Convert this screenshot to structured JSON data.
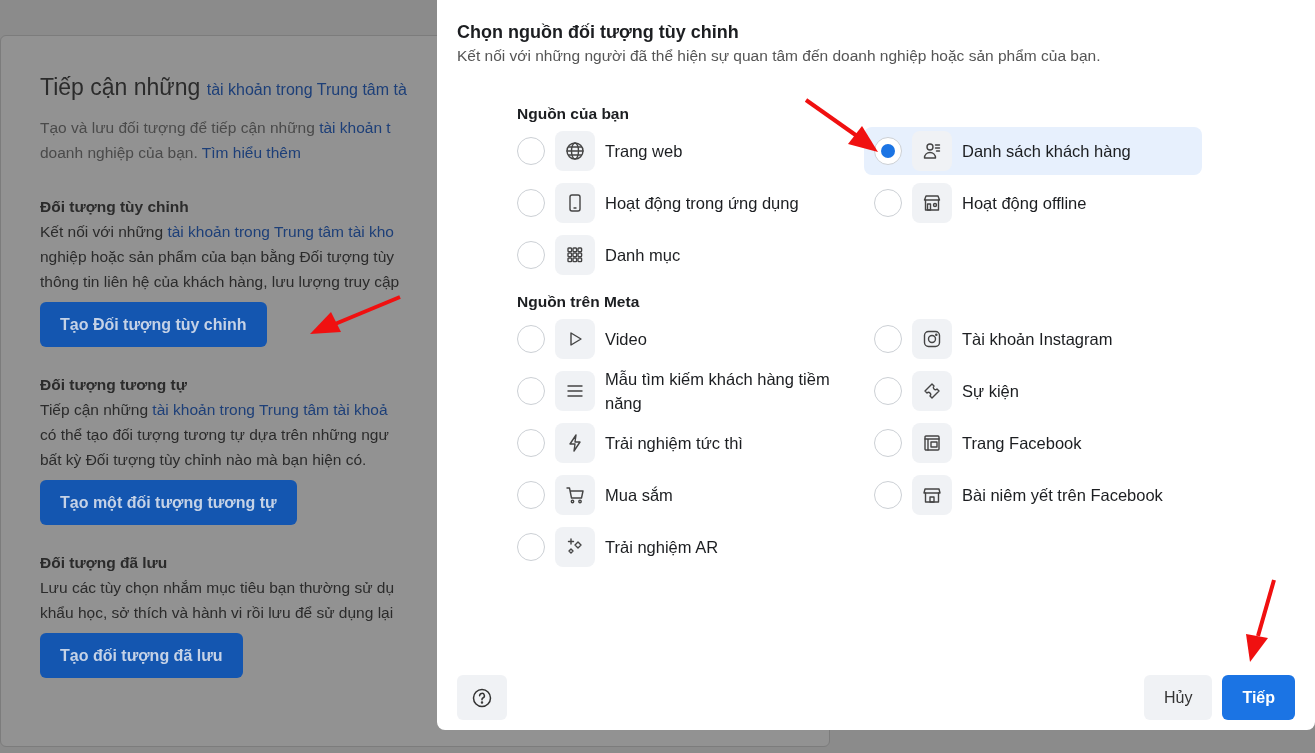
{
  "background": {
    "heading": [
      {
        "text": "Tiếp cận những ",
        "link": false
      },
      {
        "text": "tài khoản trong Trung tâm tà",
        "link": true
      }
    ],
    "intro": [
      [
        {
          "text": "Tạo và lưu đối tượng để tiếp cận những ",
          "link": false
        },
        {
          "text": "tài khoản t",
          "link": true
        }
      ],
      [
        {
          "text": "doanh nghiệp của bạn. ",
          "link": false
        },
        {
          "text": "Tìm hiểu thêm",
          "link": true
        }
      ]
    ],
    "sections": [
      {
        "title": "Đối tượng tùy chỉnh",
        "lines": [
          [
            {
              "text": "Kết nối với những ",
              "link": false
            },
            {
              "text": "tài khoản trong Trung tâm tài kho",
              "link": true
            }
          ],
          [
            {
              "text": "nghiệp hoặc sản phẩm của bạn bằng Đối tượng tùy",
              "link": false
            }
          ],
          [
            {
              "text": "thông tin liên hệ của khách hàng, lưu lượng truy cập",
              "link": false
            }
          ]
        ],
        "button": "Tạo Đối tượng tùy chỉnh"
      },
      {
        "title": "Đối tượng tương tự",
        "lines": [
          [
            {
              "text": "Tiếp cận những ",
              "link": false
            },
            {
              "text": "tài khoản trong Trung tâm tài khoả",
              "link": true
            }
          ],
          [
            {
              "text": "có thể tạo đối tượng tương tự dựa trên những ngư",
              "link": false
            }
          ],
          [
            {
              "text": "bất kỳ Đối tượng tùy chỉnh nào mà bạn hiện có.",
              "link": false
            }
          ]
        ],
        "button": "Tạo một đối tượng tương tự"
      },
      {
        "title": "Đối tượng đã lưu",
        "lines": [
          [
            {
              "text": "Lưu các tùy chọn nhắm mục tiêu bạn thường sử dụ",
              "link": false
            }
          ],
          [
            {
              "text": "khẩu học, sở thích và hành vi rồi lưu để sử dụng lại",
              "link": false
            }
          ]
        ],
        "button": "Tạo đối tượng đã lưu"
      }
    ]
  },
  "dialog": {
    "title": "Chọn nguồn đối tượng tùy chỉnh",
    "subtitle": "Kết nối với những người đã thể hiện sự quan tâm đến doanh nghiệp hoặc sản phẩm của bạn.",
    "sections": [
      {
        "title": "Nguồn của bạn",
        "columns": [
          [
            {
              "label": "Trang web",
              "kind": "globe",
              "selected": false
            },
            {
              "label": "Hoạt động trong ứng dụng",
              "kind": "phone",
              "selected": false
            },
            {
              "label": "Danh mục",
              "kind": "grid",
              "selected": false
            }
          ],
          [
            {
              "label": "Danh sách khách hàng",
              "kind": "contacts",
              "selected": true
            },
            {
              "label": "Hoạt động offline",
              "kind": "store",
              "selected": false
            }
          ]
        ]
      },
      {
        "title": "Nguồn trên Meta",
        "columns": [
          [
            {
              "label": "Video",
              "kind": "play",
              "selected": false
            },
            {
              "label": "Mẫu tìm kiếm khách hàng tiềm năng",
              "kind": "lines",
              "selected": false
            },
            {
              "label": "Trải nghiệm tức thì",
              "kind": "bolt",
              "selected": false
            },
            {
              "label": "Mua sắm",
              "kind": "cart",
              "selected": false
            },
            {
              "label": "Trải nghiệm AR",
              "kind": "sparkle",
              "selected": false
            }
          ],
          [
            {
              "label": "Tài khoản Instagram",
              "kind": "camera",
              "selected": false
            },
            {
              "label": "Sự kiện",
              "kind": "ticket",
              "selected": false
            },
            {
              "label": "Trang Facebook",
              "kind": "page",
              "selected": false
            },
            {
              "label": "Bài niêm yết trên Facebook",
              "kind": "shop",
              "selected": false
            }
          ]
        ]
      }
    ],
    "cancel": "Hủy",
    "next": "Tiếp"
  }
}
